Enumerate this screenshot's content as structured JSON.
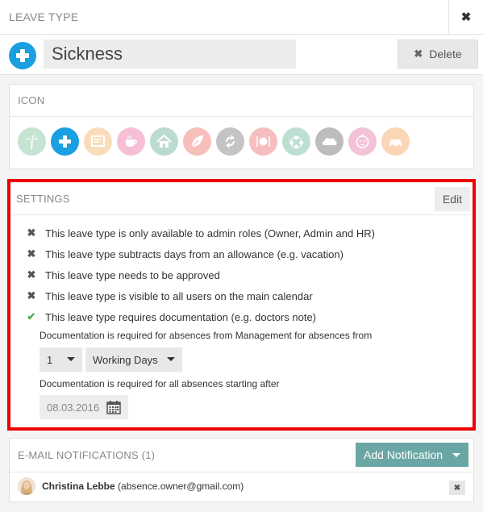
{
  "header": {
    "title": "LEAVE TYPE",
    "close_glyph": "✖"
  },
  "leave_type": {
    "name": "Sickness",
    "delete_label": "Delete",
    "delete_glyph": "✖"
  },
  "icon_section": {
    "title": "ICON",
    "icons": [
      {
        "name": "palm-tree-icon",
        "color": "#5bb37f"
      },
      {
        "name": "medical-cross-icon",
        "color": "#1a9fe0",
        "selected": true
      },
      {
        "name": "certificate-icon",
        "color": "#f0a040"
      },
      {
        "name": "coffee-icon",
        "color": "#e64a8a"
      },
      {
        "name": "home-icon",
        "color": "#3e9a7c"
      },
      {
        "name": "leaf-icon",
        "color": "#e94b3c"
      },
      {
        "name": "sync-icon",
        "color": "#5a5a5a"
      },
      {
        "name": "dining-icon",
        "color": "#e8484a"
      },
      {
        "name": "group-icon",
        "color": "#45a680"
      },
      {
        "name": "cloud-icon",
        "color": "#444444"
      },
      {
        "name": "baby-icon",
        "color": "#e0538f"
      },
      {
        "name": "car-icon",
        "color": "#f28b30"
      }
    ]
  },
  "settings": {
    "title": "SETTINGS",
    "edit_label": "Edit",
    "rules": [
      {
        "mark": "✖",
        "ok": false,
        "text": "This leave type is only available to admin roles (Owner, Admin and HR)"
      },
      {
        "mark": "✖",
        "ok": false,
        "text": "This leave type subtracts days from an allowance (e.g. vacation)"
      },
      {
        "mark": "✖",
        "ok": false,
        "text": "This leave type needs to be approved"
      },
      {
        "mark": "✖",
        "ok": false,
        "text": "This leave type is visible to all users on the main calendar"
      },
      {
        "mark": "✔",
        "ok": true,
        "text": "This leave type requires documentation (e.g. doctors note)"
      }
    ],
    "doc_required_text": "Documentation is required for absences from Management for absences from",
    "count_value": "1",
    "unit_value": "Working Days",
    "doc_all_text": "Documentation is required for all absences starting after",
    "date_value": "08.03.2016"
  },
  "notifications": {
    "title": "E-MAIL NOTIFICATIONS (1)",
    "add_label": "Add Notification",
    "recipients": [
      {
        "name": "Christina Lebbe",
        "email": "(absence.owner@gmail.com)"
      }
    ],
    "remove_glyph": "✖"
  },
  "colors": {
    "accent": "#1a9fe0",
    "highlight_border": "#ee0000",
    "add_button": "#6aa7a4",
    "check": "#4caf50"
  }
}
